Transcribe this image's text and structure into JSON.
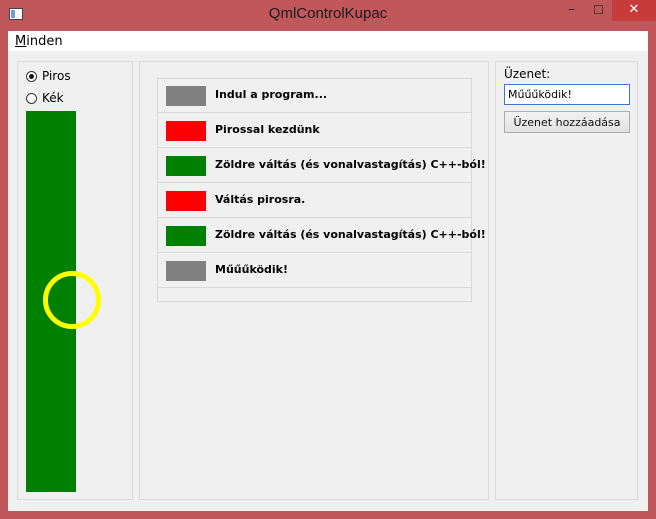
{
  "window": {
    "title": "QmlControlKupac",
    "icon": "app-window-icon",
    "controls": {
      "minimize": "–",
      "maximize": "☐",
      "close": "✕"
    }
  },
  "menu": {
    "items": [
      {
        "accel": "M",
        "rest": "inden"
      }
    ]
  },
  "left_panel": {
    "radios": [
      {
        "label": "Piros",
        "checked": true
      },
      {
        "label": "Kék",
        "checked": false
      }
    ],
    "swatch_color": "#008000",
    "indicator_color": "#ffff00"
  },
  "log": {
    "rows": [
      {
        "color": "#808080",
        "text": "Indul a program..."
      },
      {
        "color": "#ff0000",
        "text": "Pirossal kezdünk"
      },
      {
        "color": "#008000",
        "text": "Zöldre váltás (és vonalvastagítás) C++-ból!"
      },
      {
        "color": "#ff0000",
        "text": "Váltás pirosra."
      },
      {
        "color": "#008000",
        "text": "Zöldre váltás (és vonalvastagítás) C++-ból!"
      },
      {
        "color": "#808080",
        "text": "Műűűködik!"
      }
    ]
  },
  "message": {
    "label": "Üzenet:",
    "input_value": "Műűűködik!",
    "button_label": "Üzenet hozzáadása"
  }
}
